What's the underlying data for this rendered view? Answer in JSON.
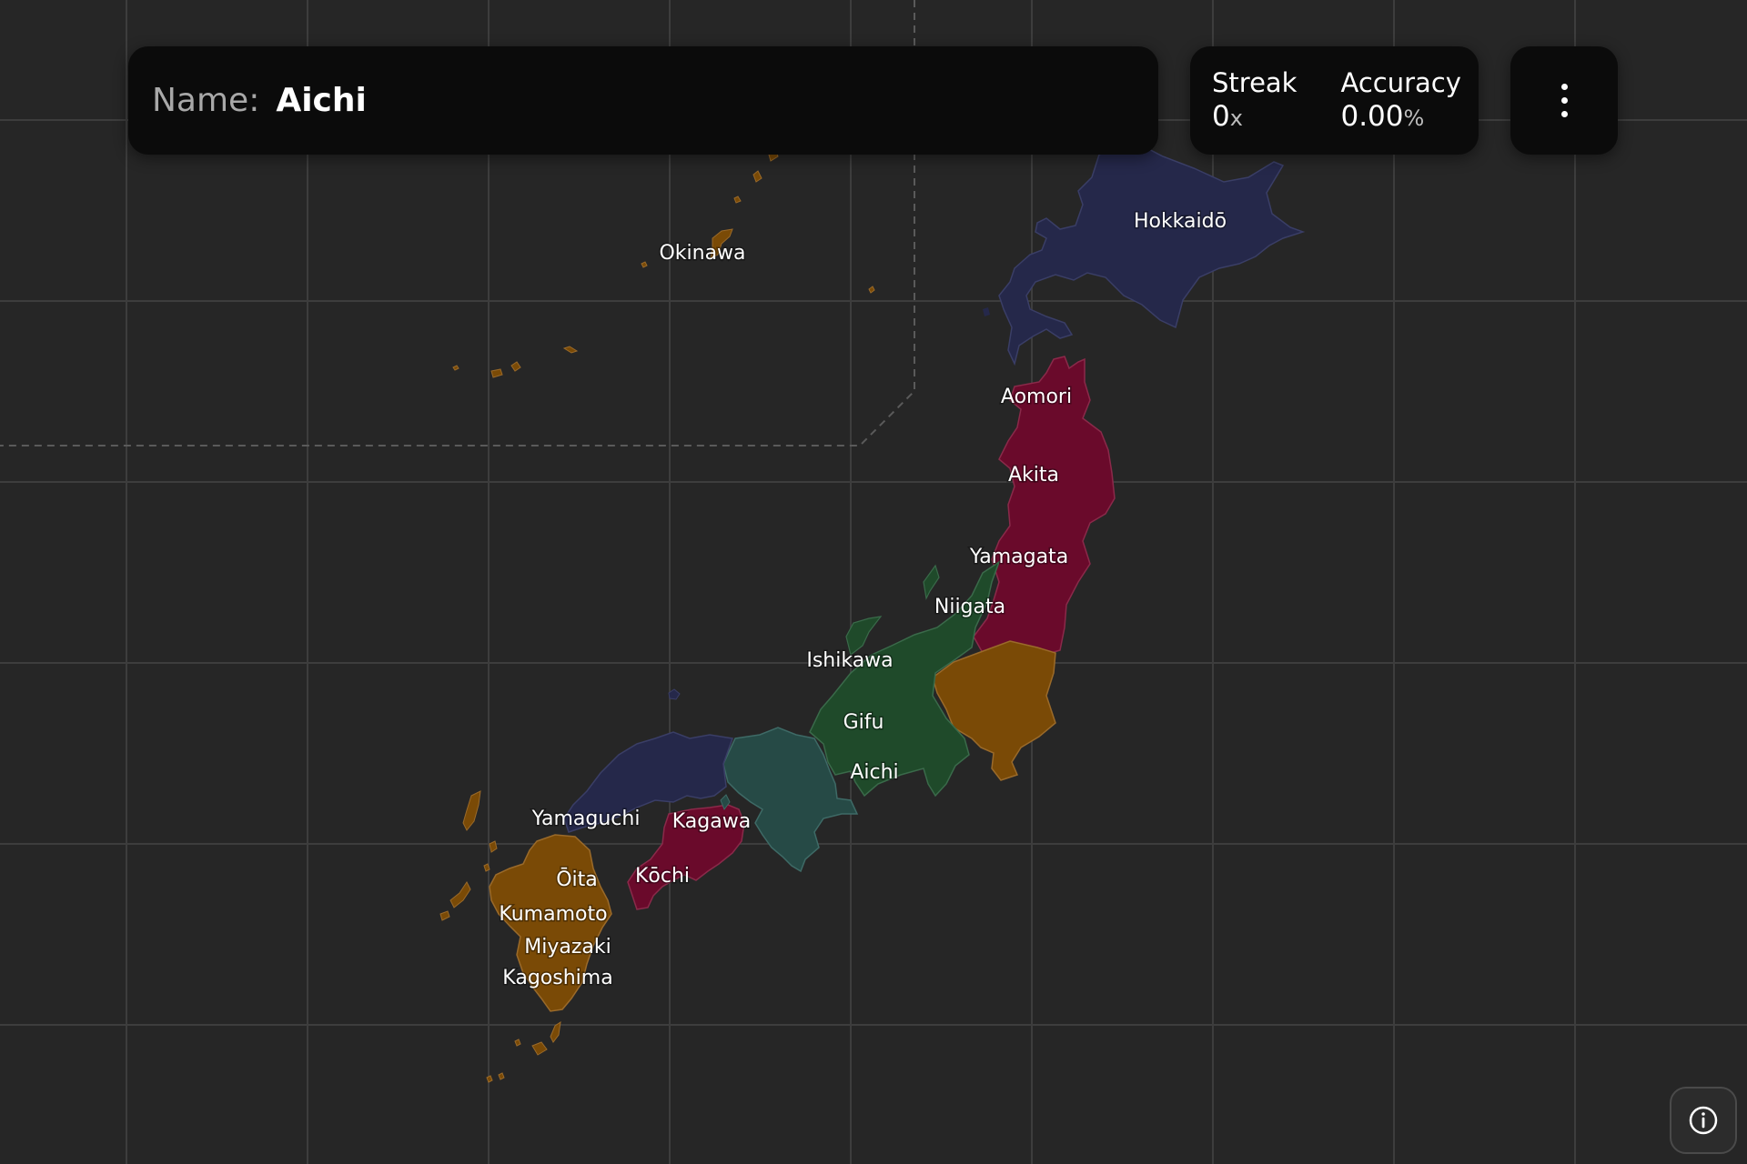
{
  "quiz": {
    "name_label": "Name:",
    "name_value": "Aichi"
  },
  "stats": {
    "streak_label": "Streak",
    "streak_value": "0",
    "streak_unit": "x",
    "accuracy_label": "Accuracy",
    "accuracy_value": "0.00",
    "accuracy_unit": "%"
  },
  "icons": {
    "menu": "more-vertical-icon",
    "info": "info-icon"
  },
  "map": {
    "colors": {
      "background": "#262626",
      "grid": "#3d3d3d",
      "hokkaido_region": "#25284a",
      "tohoku_region": "#6a0a2b",
      "kanto_region": "#7a4a06",
      "chubu_region": "#1f4a2a",
      "kansai_region": "#264a46",
      "chugoku_region": "#25284a",
      "shikoku_region": "#6a0a2b",
      "kyushu_region": "#7a4a06",
      "okinawa_region": "#7a4a06"
    },
    "labels": {
      "hokkaido": "Hokkaidō",
      "okinawa": "Okinawa",
      "aomori": "Aomori",
      "akita": "Akita",
      "yamagata": "Yamagata",
      "niigata": "Niigata",
      "ishikawa": "Ishikawa",
      "gifu": "Gifu",
      "aichi": "Aichi",
      "yamaguchi": "Yamaguchi",
      "kagawa": "Kagawa",
      "kochi": "Kōchi",
      "oita": "Ōita",
      "kumamoto": "Kumamoto",
      "miyazaki": "Miyazaki",
      "kagoshima": "Kagoshima"
    }
  }
}
